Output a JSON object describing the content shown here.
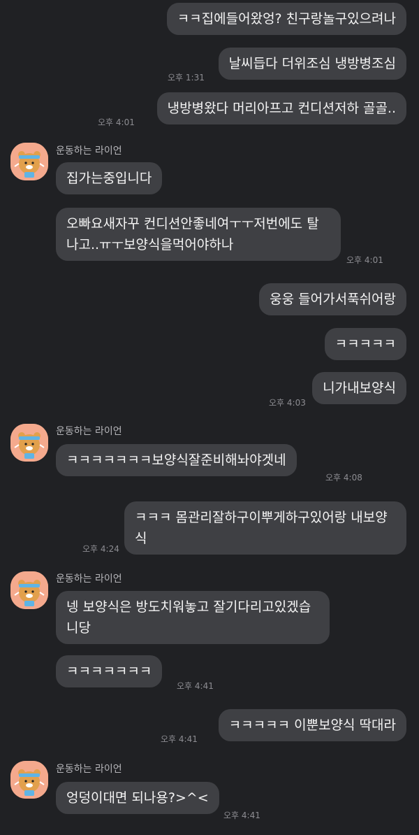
{
  "chat": {
    "sender_name": "운동하는 라이언",
    "messages": [
      {
        "id": "m1",
        "side": "me",
        "text": "ㅋㅋ집에들어왔엉? 친구랑놀구있으려나",
        "time": ""
      },
      {
        "id": "m2",
        "side": "me",
        "text": "날씨듭다 더위조심 냉방병조심",
        "time": "오후 1:31"
      },
      {
        "id": "m3",
        "side": "me",
        "text": "냉방병왔다 머리아프고 컨디션저하 골골..",
        "time": "오후 4:01"
      },
      {
        "id": "m4",
        "side": "other",
        "text": "집가는중입니다",
        "time": ""
      },
      {
        "id": "m5",
        "side": "other",
        "text": "오빠요새자꾸 컨디션안좋네여ㅜㅜ저번에도 탈나고..ㅠㅜ보양식을먹어야하나",
        "time": "오후 4:01"
      },
      {
        "id": "m6",
        "side": "me",
        "text": "웅웅 들어가서푹쉬어랑",
        "time": ""
      },
      {
        "id": "m7",
        "side": "me",
        "text": "ㅋㅋㅋㅋㅋ",
        "time": ""
      },
      {
        "id": "m8",
        "side": "me",
        "text": "니가내보양식",
        "time": "오후 4:03"
      },
      {
        "id": "m9",
        "side": "other",
        "text": "ㅋㅋㅋㅋㅋㅋㅋ보양식잘준비해놔야겟네",
        "time": "오후 4:08"
      },
      {
        "id": "m10",
        "side": "me",
        "text": "ㅋㅋㅋ 몸관리잘하구이뿌게하구있어랑 내보양식",
        "time": "오후 4:24"
      },
      {
        "id": "m11",
        "side": "other",
        "text": "넹 보양식은 방도치워놓고 잘기다리고있겠습니당",
        "time": ""
      },
      {
        "id": "m12",
        "side": "other",
        "text": "ㅋㅋㅋㅋㅋㅋㅋ",
        "time": "오후 4:41"
      },
      {
        "id": "m13",
        "side": "me",
        "text": "ㅋㅋㅋㅋㅋ 이뿐보양식 딱대라",
        "time": "오후 4:41"
      },
      {
        "id": "m14",
        "side": "other",
        "text": "엉덩이대면 되나용?>^<",
        "time": "오후 4:41"
      }
    ]
  },
  "colors": {
    "background": "#202124",
    "bubble": "#3f4044",
    "avatar_bg": "#f4a98d"
  },
  "avatar_icon": "ryan-exercise-icon"
}
